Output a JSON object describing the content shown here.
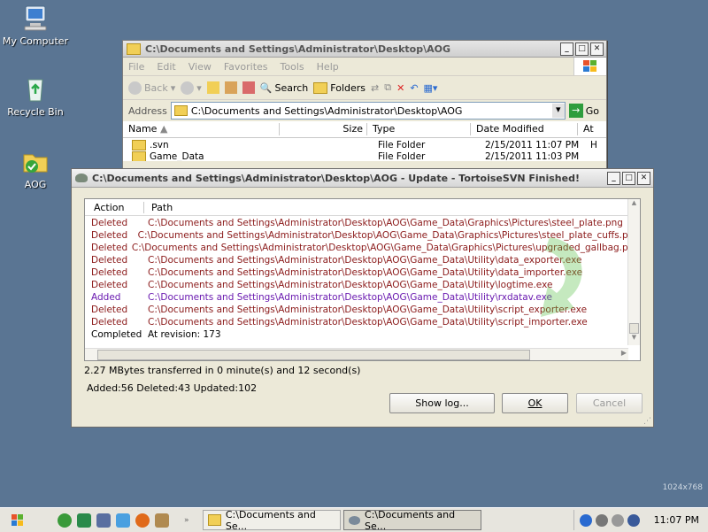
{
  "desktop": {
    "icons": [
      {
        "label": "My Computer"
      },
      {
        "label": "Recycle Bin"
      },
      {
        "label": "AOG"
      }
    ],
    "resolution": "1024x768"
  },
  "explorer": {
    "title": "C:\\Documents and Settings\\Administrator\\Desktop\\AOG",
    "menu": [
      "File",
      "Edit",
      "View",
      "Favorites",
      "Tools",
      "Help"
    ],
    "toolbar": {
      "back": "Back",
      "search": "Search",
      "folders": "Folders"
    },
    "address_label": "Address",
    "address": "C:\\Documents and Settings\\Administrator\\Desktop\\AOG",
    "go": "Go",
    "columns": [
      "Name",
      "Size",
      "Type",
      "Date Modified",
      "At"
    ],
    "rows": [
      {
        "name": ".svn",
        "type": "File Folder",
        "date": "2/15/2011 11:07 PM",
        "attr": "H"
      },
      {
        "name": "Game_Data",
        "type": "File Folder",
        "date": "2/15/2011 11:03 PM",
        "attr": ""
      }
    ]
  },
  "svn_dialog": {
    "title": "C:\\Documents and Settings\\Administrator\\Desktop\\AOG - Update - TortoiseSVN Finished!",
    "columns": {
      "action": "Action",
      "path": "Path"
    },
    "rows": [
      {
        "action": "Deleted",
        "path": "C:\\Documents and Settings\\Administrator\\Desktop\\AOG\\Game_Data\\Graphics\\Pictures\\steel_plate.png",
        "kind": "deleted"
      },
      {
        "action": "Deleted",
        "path": "C:\\Documents and Settings\\Administrator\\Desktop\\AOG\\Game_Data\\Graphics\\Pictures\\steel_plate_cuffs.png",
        "kind": "deleted"
      },
      {
        "action": "Deleted",
        "path": "C:\\Documents and Settings\\Administrator\\Desktop\\AOG\\Game_Data\\Graphics\\Pictures\\upgraded_gallbag.png",
        "kind": "deleted"
      },
      {
        "action": "Deleted",
        "path": "C:\\Documents and Settings\\Administrator\\Desktop\\AOG\\Game_Data\\Utility\\data_exporter.exe",
        "kind": "deleted"
      },
      {
        "action": "Deleted",
        "path": "C:\\Documents and Settings\\Administrator\\Desktop\\AOG\\Game_Data\\Utility\\data_importer.exe",
        "kind": "deleted"
      },
      {
        "action": "Deleted",
        "path": "C:\\Documents and Settings\\Administrator\\Desktop\\AOG\\Game_Data\\Utility\\logtime.exe",
        "kind": "deleted"
      },
      {
        "action": "Added",
        "path": "C:\\Documents and Settings\\Administrator\\Desktop\\AOG\\Game_Data\\Utility\\rxdatav.exe",
        "kind": "added"
      },
      {
        "action": "Deleted",
        "path": "C:\\Documents and Settings\\Administrator\\Desktop\\AOG\\Game_Data\\Utility\\script_exporter.exe",
        "kind": "deleted"
      },
      {
        "action": "Deleted",
        "path": "C:\\Documents and Settings\\Administrator\\Desktop\\AOG\\Game_Data\\Utility\\script_importer.exe",
        "kind": "deleted"
      },
      {
        "action": "Completed",
        "path": "At revision: 173",
        "kind": "completed"
      }
    ],
    "transfer": "2.27 MBytes transferred in 0 minute(s) and 12 second(s)",
    "summary": "Added:56 Deleted:43 Updated:102",
    "buttons": {
      "show_log": "Show log...",
      "ok": "OK",
      "cancel": "Cancel"
    }
  },
  "taskbar": {
    "tasks": [
      {
        "label": "C:\\Documents and Se..."
      },
      {
        "label": "C:\\Documents and Se..."
      }
    ],
    "clock": "11:07 PM"
  }
}
